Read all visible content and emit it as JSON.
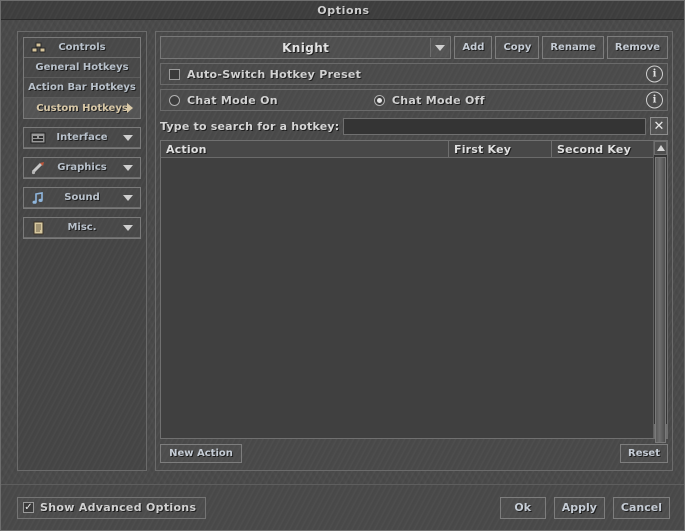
{
  "window": {
    "title": "Options"
  },
  "sidebar": {
    "groups": [
      {
        "name": "controls-group",
        "header": {
          "label": "Controls",
          "icon": "controls-icon",
          "expanded": true
        },
        "items": [
          {
            "label": "General Hotkeys",
            "selected": false
          },
          {
            "label": "Action Bar Hotkeys",
            "selected": false
          },
          {
            "label": "Custom Hotkeys",
            "selected": true,
            "arrow": "chevron-right-icon"
          }
        ]
      },
      {
        "name": "interface-group",
        "header": {
          "label": "Interface",
          "icon": "interface-icon",
          "expanded": false
        },
        "items": []
      },
      {
        "name": "graphics-group",
        "header": {
          "label": "Graphics",
          "icon": "graphics-icon",
          "expanded": false
        },
        "items": []
      },
      {
        "name": "sound-group",
        "header": {
          "label": "Sound",
          "icon": "sound-icon",
          "expanded": false
        },
        "items": []
      },
      {
        "name": "misc-group",
        "header": {
          "label": "Misc.",
          "icon": "misc-icon",
          "expanded": false
        },
        "items": []
      }
    ]
  },
  "main": {
    "preset": {
      "selected": "Knight",
      "dropdown_icon": "chevron-down-icon",
      "buttons": [
        {
          "label": "Add",
          "name": "add-preset-button"
        },
        {
          "label": "Copy",
          "name": "copy-preset-button"
        },
        {
          "label": "Rename",
          "name": "rename-preset-button"
        },
        {
          "label": "Remove",
          "name": "remove-preset-button"
        }
      ]
    },
    "auto_switch": {
      "label": "Auto-Switch Hotkey Preset",
      "checked": false,
      "info_icon": "info-icon",
      "info_glyph": "i"
    },
    "chat_mode": {
      "on_label": "Chat Mode On",
      "off_label": "Chat Mode Off",
      "selected": "off",
      "info_icon": "info-icon",
      "info_glyph": "i"
    },
    "search": {
      "label": "Type to search for a hotkey:",
      "value": "",
      "placeholder": "",
      "clear_glyph": "✕"
    },
    "table": {
      "columns": [
        "Action",
        "First Key",
        "Second Key"
      ],
      "rows": []
    },
    "footer": {
      "new_action_label": "New Action",
      "reset_label": "Reset"
    }
  },
  "bottom": {
    "advanced": {
      "label": "Show Advanced Options",
      "checked": true,
      "check_glyph": "✓"
    },
    "buttons": [
      {
        "label": "Ok",
        "name": "ok-button"
      },
      {
        "label": "Apply",
        "name": "apply-button"
      },
      {
        "label": "Cancel",
        "name": "cancel-button"
      }
    ]
  }
}
